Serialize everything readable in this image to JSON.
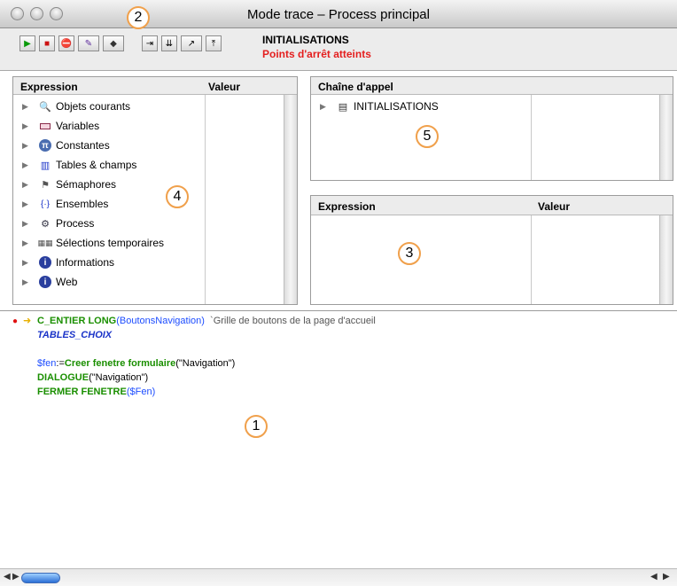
{
  "window": {
    "title": "Mode trace – Process principal"
  },
  "toolbar": {
    "status_line1": "INITIALISATIONS",
    "status_line2": "Points d'arrêt atteints",
    "status_line2_color": "#e41f1f",
    "buttons": [
      {
        "icon": "run-icon",
        "glyph": "▶"
      },
      {
        "icon": "stop-icon",
        "glyph": "■"
      },
      {
        "icon": "abort-icon",
        "glyph": "⛔"
      },
      {
        "icon": "edit-icon",
        "glyph": "✎"
      },
      {
        "icon": "trace-icon",
        "glyph": "◆"
      },
      {
        "icon": "step-over-icon",
        "glyph": "⇥"
      },
      {
        "icon": "step-into-icon",
        "glyph": "⇊"
      },
      {
        "icon": "step-out-icon",
        "glyph": "↗"
      },
      {
        "icon": "step-top-icon",
        "glyph": "⤒"
      }
    ]
  },
  "expression_pane": {
    "col_expression": "Expression",
    "col_valeur": "Valeur",
    "items": [
      {
        "label": "Objets courants",
        "icon": "magnifier-icon"
      },
      {
        "label": "Variables",
        "icon": "variables-icon"
      },
      {
        "label": "Constantes",
        "icon": "pi-icon"
      },
      {
        "label": "Tables & champs",
        "icon": "table-icon"
      },
      {
        "label": "Sémaphores",
        "icon": "semaphore-icon"
      },
      {
        "label": "Ensembles",
        "icon": "ensembles-icon"
      },
      {
        "label": "Process",
        "icon": "process-icon"
      },
      {
        "label": "Sélections temporaires",
        "icon": "selection-icon"
      },
      {
        "label": "Informations",
        "icon": "info-icon"
      },
      {
        "label": "Web",
        "icon": "web-icon"
      }
    ]
  },
  "call_chain_pane": {
    "title": "Chaîne d'appel",
    "items": [
      {
        "label": "INITIALISATIONS",
        "icon": "method-icon"
      }
    ]
  },
  "custom_expression_pane": {
    "col_expression": "Expression",
    "col_valeur": "Valeur"
  },
  "code": {
    "line1": {
      "kw": "C_ENTIER LONG",
      "open": "(",
      "param": "BoutonsNavigation",
      "close": ")",
      "comment": "`Grille de boutons de la page d'accueil"
    },
    "line2": {
      "method": "TABLES_CHOIX"
    },
    "line3": {
      "var": "$fen",
      "assign": ":=",
      "kw": "Creer fenetre formulaire",
      "arg": "(\"Navigation\")"
    },
    "line4": {
      "kw": "DIALOGUE",
      "arg": "(\"Navigation\")"
    },
    "line5": {
      "kw": "FERMER FENETRE",
      "open": "(",
      "var": "$Fen",
      "close": ")"
    }
  },
  "callouts": {
    "c1": "1",
    "c2": "2",
    "c3": "3",
    "c4": "4",
    "c5": "5"
  }
}
